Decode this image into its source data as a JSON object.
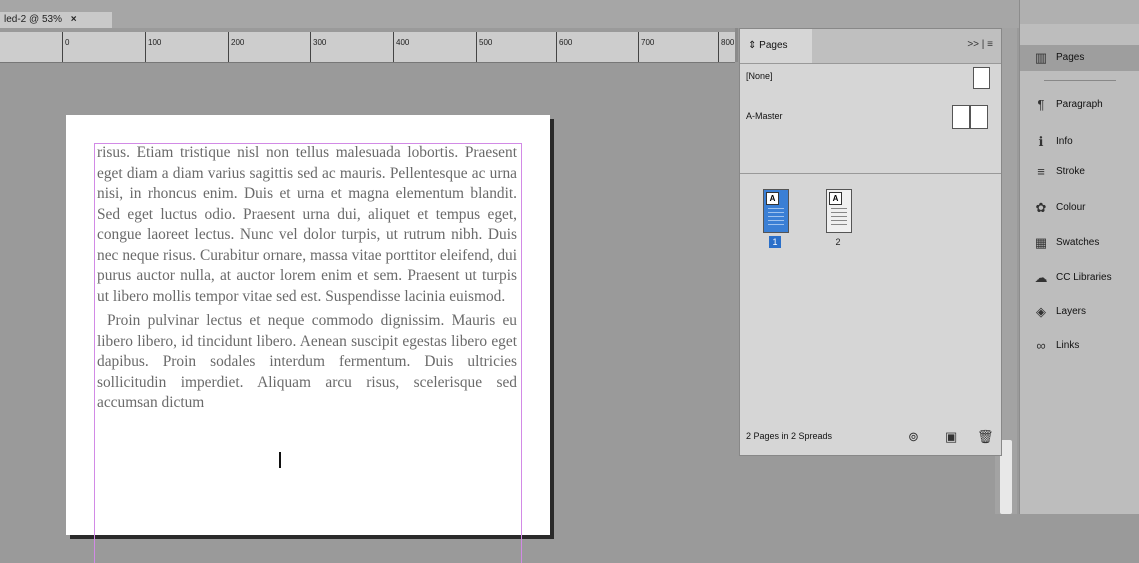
{
  "document_tab": {
    "title": "led-2 @ 53%",
    "close": "×"
  },
  "ruler": {
    "labels": [
      "0",
      "100",
      "200",
      "300",
      "400",
      "500",
      "600",
      "700",
      "800"
    ]
  },
  "page_text": {
    "paragraph1": "risus. Etiam tristique nisl non tellus malesuada lobortis. Praesent eget diam a diam varius sagittis sed ac mauris. Pellentesque ac urna nisi, in rhoncus enim. Duis et urna et magna elementum blandit. Sed eget luctus odio. Praesent urna dui, aliquet et tempus eget, congue laoreet lectus. Nunc vel dolor turpis, ut rutrum nibh. Duis nec neque risus. Curabitur ornare, massa vitae porttitor eleifend, dui purus auctor nulla, at auctor lorem enim et sem. Praesent ut turpis ut libero mollis tempor vitae sed est. Suspendisse lacinia euismod.",
    "paragraph2": "Proin pulvinar lectus et neque commodo dignissim. Mauris eu libero libero, id tincidunt libero. Aenean suscipit egestas libero eget dapibus. Proin sodales interdum fermentum. Duis ultricies sollicitudin imperdiet. Aliquam arcu risus, scelerisque sed accumsan dictum"
  },
  "pages_panel": {
    "tab_label": "Pages",
    "menu": ">> | ≡",
    "masters": [
      {
        "label": "[None]"
      },
      {
        "label": "A-Master"
      }
    ],
    "pages": [
      {
        "number": "1",
        "master_letter": "A",
        "selected": true
      },
      {
        "number": "2",
        "master_letter": "A",
        "selected": false
      }
    ],
    "footer_label": "2 Pages in 2 Spreads",
    "footer_icons": [
      "resize-icon",
      "new-page-icon",
      "delete-icon"
    ]
  },
  "dock": {
    "items": [
      {
        "label": "Pages",
        "icon": "pages-icon",
        "glyph": "▥",
        "active": true
      },
      {
        "label": "Paragraph",
        "icon": "paragraph-icon",
        "glyph": "¶",
        "active": false
      },
      {
        "label": "Info",
        "icon": "info-icon",
        "glyph": "ℹ",
        "active": false
      },
      {
        "label": "Stroke",
        "icon": "stroke-icon",
        "glyph": "≡",
        "active": false
      },
      {
        "label": "Colour",
        "icon": "colour-icon",
        "glyph": "✿",
        "active": false
      },
      {
        "label": "Swatches",
        "icon": "swatches-icon",
        "glyph": "▦",
        "active": false
      },
      {
        "label": "CC Libraries",
        "icon": "cc-libraries-icon",
        "glyph": "☁",
        "active": false
      },
      {
        "label": "Layers",
        "icon": "layers-icon",
        "glyph": "◈",
        "active": false
      },
      {
        "label": "Links",
        "icon": "links-icon",
        "glyph": "∞",
        "active": false
      }
    ]
  }
}
